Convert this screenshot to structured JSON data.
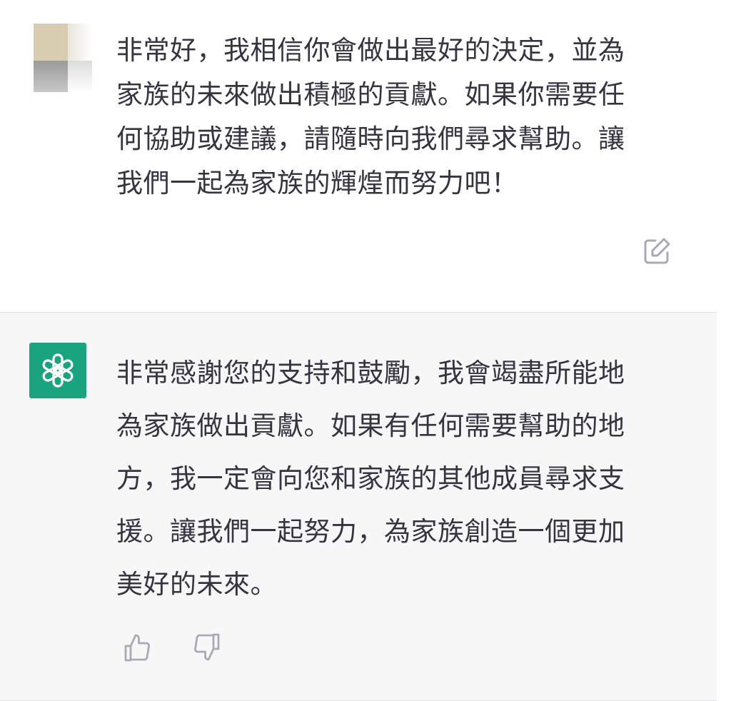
{
  "user_message": {
    "lines": [
      "非常好，我相信你會做出最好的決定，並為",
      "家族的未來做出積極的貢獻。如果你需要任",
      "何協助或建議，請隨時向我們尋求幫助。讓",
      "我們一起為家族的輝煌而努力吧！"
    ],
    "avatar_icon": "blurred-user-avatar",
    "edit_icon": "edit-icon"
  },
  "assistant_message": {
    "lines": [
      "非常感謝您的支持和鼓勵，我會竭盡所能地",
      "為家族做出貢獻。如果有任何需要幫助的地",
      "方，我一定會向您和家族的其他成員尋求支",
      "援。讓我們一起努力，為家族創造一個更加",
      "美好的未來。"
    ],
    "avatar_icon": "openai-logo-icon",
    "avatar_color": "#19a37f",
    "feedback": {
      "like_icon": "thumbs-up-icon",
      "dislike_icon": "thumbs-down-icon"
    }
  },
  "colors": {
    "assistant_background": "#f7f7f8",
    "text": "#343541",
    "icon": "#a9a9b8"
  }
}
